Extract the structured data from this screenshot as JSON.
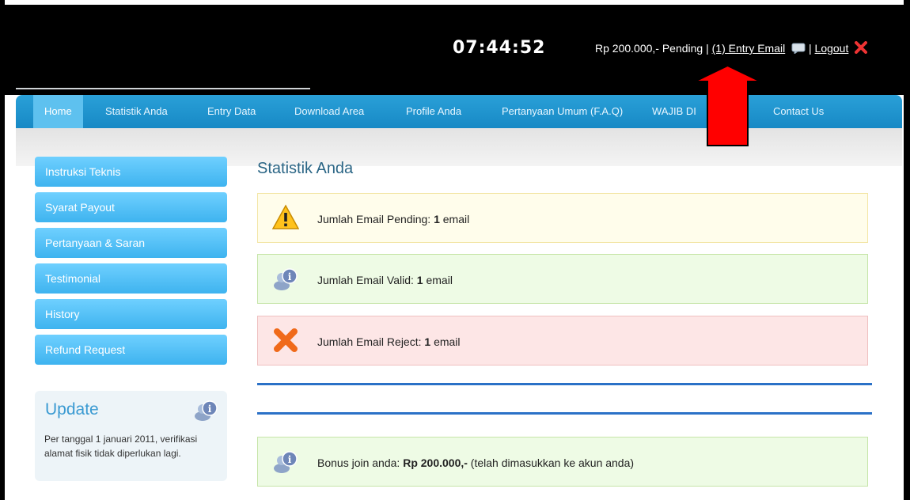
{
  "header": {
    "clock": "07:44:52",
    "balance_text": "Rp 200.000,- Pending | ",
    "entry_email_link": "(1) Entry Email",
    "separator": " | ",
    "logout_link": "Logout"
  },
  "nav": {
    "items": [
      {
        "label": "Home",
        "active": true
      },
      {
        "label": "Statistik Anda"
      },
      {
        "label": "Entry Data"
      },
      {
        "label": "Download Area"
      },
      {
        "label": "Profile Anda"
      },
      {
        "label": "Pertanyaan Umum (F.A.Q)"
      },
      {
        "label": "WAJIB DI"
      },
      {
        "label": "Contact Us"
      }
    ]
  },
  "sidebar": {
    "items": [
      {
        "label": "Instruksi Teknis"
      },
      {
        "label": "Syarat Payout"
      },
      {
        "label": "Pertanyaan & Saran"
      },
      {
        "label": "Testimonial"
      },
      {
        "label": "History"
      },
      {
        "label": "Refund Request"
      }
    ],
    "update": {
      "title": "Update",
      "text": "Per tanggal 1 januari 2011, verifikasi alamat fisik tidak diperlukan lagi."
    }
  },
  "main": {
    "title": "Statistik Anda",
    "messages": [
      {
        "prefix": "Jumlah Email Pending: ",
        "value": "1",
        "suffix": " email",
        "icon": "warning-icon"
      },
      {
        "prefix": "Jumlah Email Valid: ",
        "value": "1",
        "suffix": " email",
        "icon": "info-user-icon"
      },
      {
        "prefix": "Jumlah Email Reject: ",
        "value": "1",
        "suffix": " email",
        "icon": "reject-x-icon"
      }
    ],
    "bonus": {
      "prefix": "Bonus join anda: ",
      "value": "Rp 200.000,-",
      "suffix": " (telah dimasukkan ke akun anda)",
      "icon": "info-user-icon"
    }
  },
  "colors": {
    "nav_blue": "#1f95d0",
    "sidebar_blue": "#4fc0f7",
    "annotation_arrow": "#ff0000"
  }
}
